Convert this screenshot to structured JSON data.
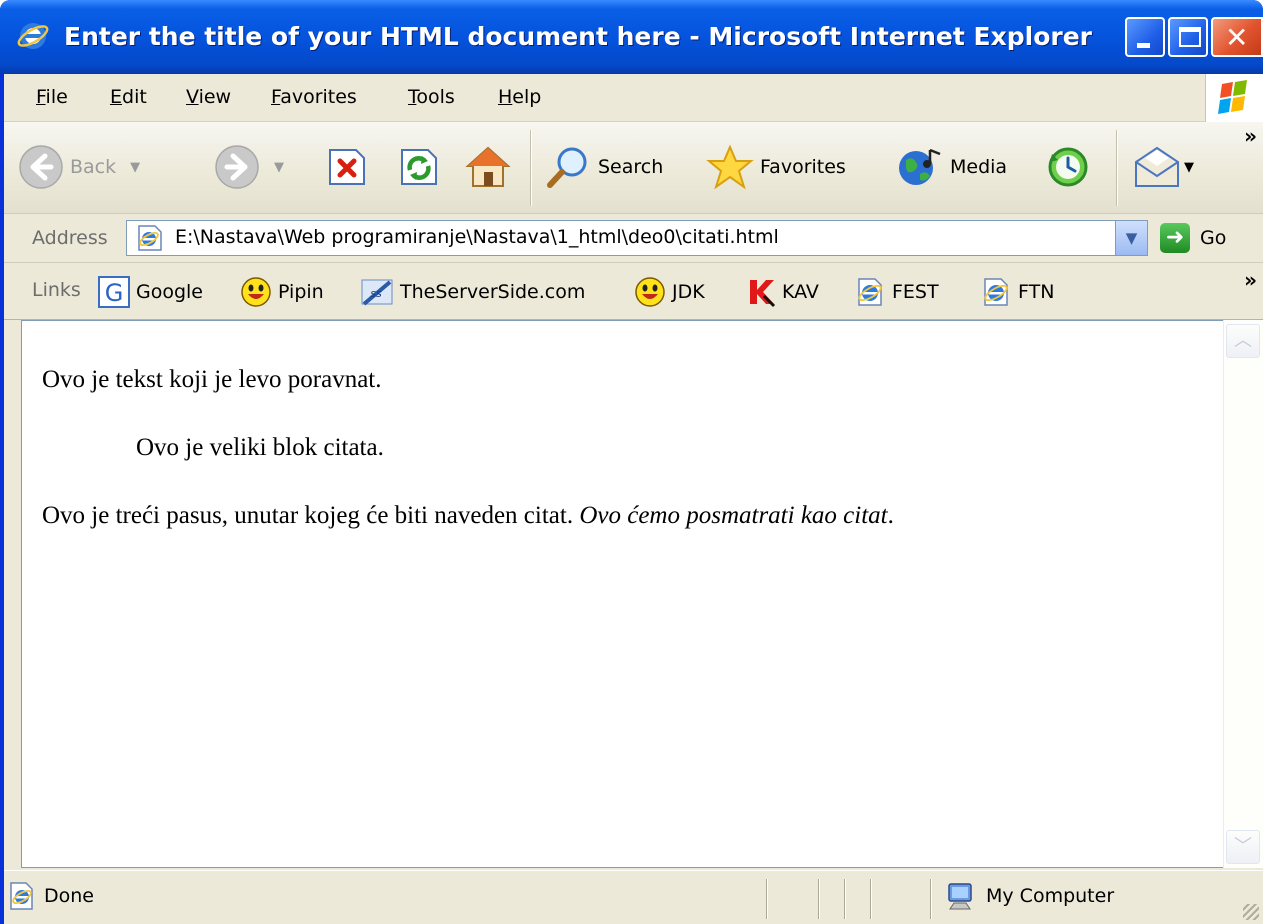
{
  "window": {
    "title": "Enter the title of your HTML document here - Microsoft Internet Explorer"
  },
  "menu": {
    "items": [
      "File",
      "Edit",
      "View",
      "Favorites",
      "Tools",
      "Help"
    ]
  },
  "toolbar": {
    "back_label": "Back",
    "search_label": "Search",
    "favorites_label": "Favorites",
    "media_label": "Media",
    "more": "»"
  },
  "address": {
    "label": "Address",
    "value": "E:\\Nastava\\Web programiranje\\Nastava\\1_html\\deo0\\citati.html",
    "go_label": "Go"
  },
  "links": {
    "label": "Links",
    "items": [
      "Google",
      "Pipin",
      "TheServerSide.com",
      "JDK",
      "KAV",
      "FEST",
      "FTN"
    ],
    "more": "»"
  },
  "document": {
    "para1": "Ovo je tekst koji je levo poravnat.",
    "blockquote": "Ovo je veliki blok citata.",
    "para3_text": "Ovo je treći pasus, unutar kojeg će biti naveden citat.",
    "para3_quote": "Ovo ćemo posmatrati kao citat",
    "para3_end": "."
  },
  "status": {
    "text": "Done",
    "zone": "My Computer"
  },
  "colors": {
    "titlebar": "#0553de",
    "frame": "#ece9d8",
    "close_button": "#e2542f"
  }
}
